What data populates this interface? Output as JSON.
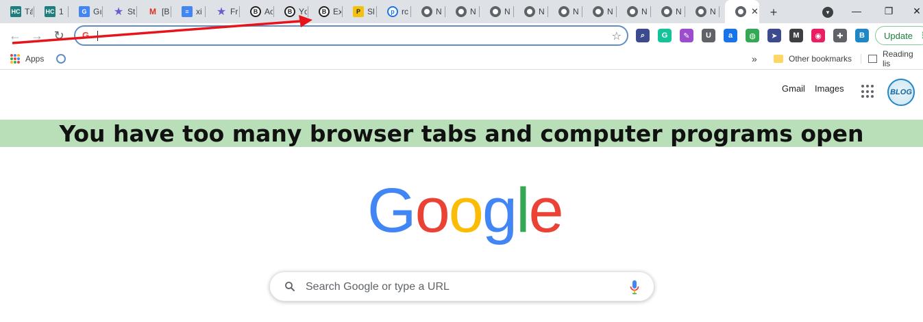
{
  "tabs": [
    {
      "label": "Tá",
      "icon": "helpcenter-icon",
      "favtext": "HC",
      "kind": "hc"
    },
    {
      "label": "1",
      "icon": "helpcenter-icon",
      "favtext": "HC",
      "kind": "hc"
    },
    {
      "label": "Gı",
      "icon": "google-translate-icon",
      "favtext": "G",
      "kind": "gtr"
    },
    {
      "label": "St",
      "icon": "star-icon",
      "favtext": "★",
      "kind": "star"
    },
    {
      "label": "[B",
      "icon": "gmail-icon",
      "favtext": "M",
      "kind": "gmail"
    },
    {
      "label": "xi",
      "icon": "docs-icon",
      "favtext": "≡",
      "kind": "docs"
    },
    {
      "label": "Fr",
      "icon": "star-icon",
      "favtext": "★",
      "kind": "star"
    },
    {
      "label": "Ac",
      "icon": "b-circle-icon",
      "favtext": "B",
      "kind": "bcirc"
    },
    {
      "label": "Yc",
      "icon": "b-circle-icon",
      "favtext": "B",
      "kind": "bcirc"
    },
    {
      "label": "Ex",
      "icon": "b-circle-icon",
      "favtext": "B",
      "kind": "bcirc"
    },
    {
      "label": "Sl",
      "icon": "pdf-icon",
      "favtext": "P",
      "kind": "sl"
    },
    {
      "label": "rc",
      "icon": "p-circle-icon",
      "favtext": "p",
      "kind": "pcirc"
    },
    {
      "label": "N",
      "icon": "chrome-page-icon",
      "favtext": "",
      "kind": "ng"
    },
    {
      "label": "N",
      "icon": "chrome-page-icon",
      "favtext": "",
      "kind": "ng"
    },
    {
      "label": "N",
      "icon": "chrome-page-icon",
      "favtext": "",
      "kind": "ng"
    },
    {
      "label": "N",
      "icon": "chrome-page-icon",
      "favtext": "",
      "kind": "ng"
    },
    {
      "label": "N",
      "icon": "chrome-page-icon",
      "favtext": "",
      "kind": "ng"
    },
    {
      "label": "N",
      "icon": "chrome-page-icon",
      "favtext": "",
      "kind": "ng"
    },
    {
      "label": "N",
      "icon": "chrome-page-icon",
      "favtext": "",
      "kind": "ng"
    },
    {
      "label": "N",
      "icon": "chrome-page-icon",
      "favtext": "",
      "kind": "ng"
    },
    {
      "label": "N",
      "icon": "chrome-page-icon",
      "favtext": "",
      "kind": "ng"
    }
  ],
  "active_tab": {
    "icon": "chrome-page-icon",
    "close": "✕"
  },
  "tabstrip": {
    "new_tab": "+",
    "search_tabs": "▾",
    "minimize": "—",
    "restore": "❐",
    "close": "✕"
  },
  "toolbar": {
    "back": "←",
    "forward": "→",
    "reload": "↻",
    "omnibox_value": "",
    "bookmark_star": "☆",
    "update_label": "Update",
    "menu": "⋮",
    "extensions": [
      "zoom-icon",
      "grammarly-icon",
      "pen-icon",
      "ublock-icon",
      "at-icon",
      "globe-icon",
      "cursor-icon",
      "m-icon",
      "color-icon",
      "puzzle-icon",
      "blog-icon"
    ]
  },
  "bookmarks": {
    "apps_label": "Apps",
    "overflow": "»",
    "other_label": "Other bookmarks",
    "reading_label": "Reading lis"
  },
  "page": {
    "gmail_link": "Gmail",
    "images_link": "Images",
    "avatar_text": "BLOG",
    "banner_text": "You have too many browser tabs and computer programs open",
    "logo_letters": [
      "G",
      "o",
      "o",
      "g",
      "l",
      "e"
    ],
    "logo_colors": [
      "#4285f4",
      "#ea4335",
      "#fbbc05",
      "#4285f4",
      "#34a853",
      "#ea4335"
    ],
    "search_placeholder": "Search Google or type a URL"
  },
  "colors": {
    "banner_bg": "#b9dfb9",
    "arrow": "#e8141c",
    "update_text": "#188038"
  }
}
